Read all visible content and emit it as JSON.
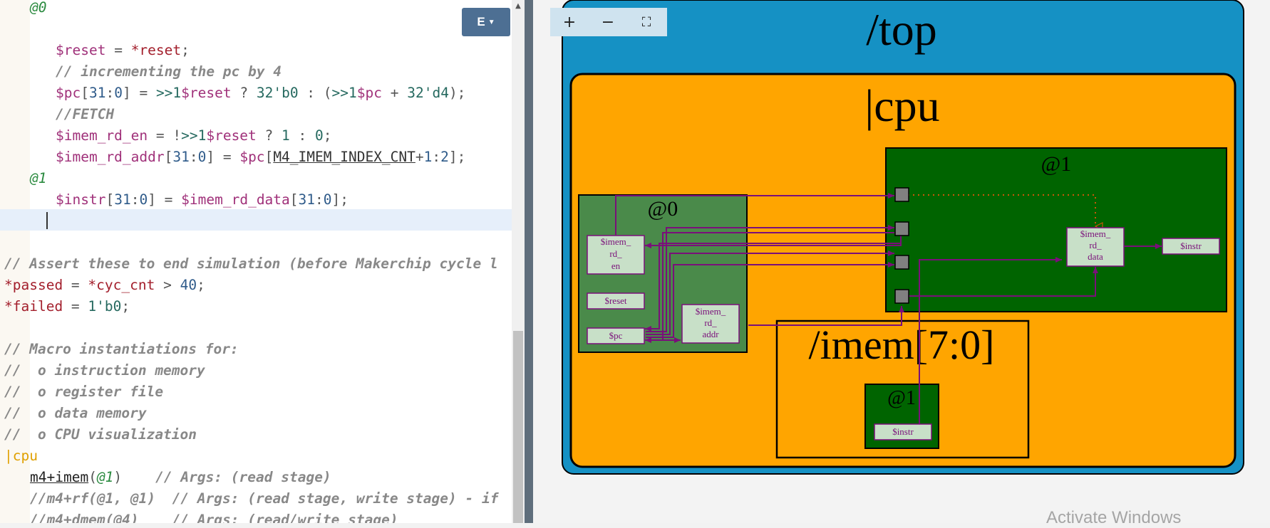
{
  "editor": {
    "stage_top": "@0",
    "line_reset": [
      "$reset",
      " = ",
      "*reset",
      ";"
    ],
    "comment_pc": "// incrementing the pc by 4",
    "line_pc": [
      "$pc",
      "[",
      "31",
      ":",
      "0",
      "] = ",
      ">>1",
      "$reset",
      " ? ",
      "32'b0",
      " : (",
      ">>1",
      "$pc",
      " + ",
      "32'd4",
      ");"
    ],
    "comment_fetch": "//FETCH",
    "line_en": [
      "$imem_rd_en",
      " = !",
      ">>1",
      "$reset",
      " ? ",
      "1",
      " : ",
      "0",
      ";"
    ],
    "line_addr": [
      "$imem_rd_addr",
      "[",
      "31",
      ":",
      "0",
      "] = ",
      "$pc",
      "[",
      "M4_IMEM_INDEX_CNT",
      "+",
      "1",
      ":",
      "2",
      "];"
    ],
    "stage_one": "@1",
    "line_instr": [
      "$instr",
      "[",
      "31",
      ":",
      "0",
      "] = ",
      "$imem_rd_data",
      "[",
      "31",
      ":",
      "0",
      "];"
    ],
    "comment_assert": "// Assert these to end simulation (before Makerchip cycle l",
    "line_passed": [
      "*passed",
      " = ",
      "*cyc_cnt",
      " > ",
      "40",
      ";"
    ],
    "line_failed": [
      "*failed",
      " = ",
      "1'b0",
      ";"
    ],
    "comment_macro": "// Macro instantiations for:",
    "comment_o1": "//  o instruction memory",
    "comment_o2": "//  o register file",
    "comment_o3": "//  o data memory",
    "comment_o4": "//  o CPU visualization",
    "pipe_cpu": "|cpu",
    "line_imem": [
      "m4+imem",
      "(",
      "@1",
      ")",
      "    // Args: (read stage)"
    ],
    "line_rf": "//m4+rf(@1, @1)  // Args: (read stage, write stage) - if",
    "line_dmem": "//m4+dmem(@4)    // Args: (read/write stage)",
    "e_button_label": "E"
  },
  "zoom": {
    "plus": "+",
    "minus": "−",
    "fit": "⛶"
  },
  "diagram": {
    "top_label": "/top",
    "cpu_label": "|cpu",
    "stage0_label": "@0",
    "stage1_label": "@1",
    "imem_label": "/imem[7:0]",
    "imem_stage_label": "@1",
    "node_imem_rd_en": [
      "$imem_",
      "rd_",
      "en"
    ],
    "node_reset": "$reset",
    "node_pc": "$pc",
    "node_imem_rd_addr": [
      "$imem_",
      "rd_",
      "addr"
    ],
    "node_imem_rd_data": [
      "$imem_",
      "rd_",
      "data"
    ],
    "node_instr": "$instr",
    "node_imem_instr": "$instr",
    "colors": {
      "top": "#1591c4",
      "cpu": "#ffa500",
      "stage0": "#4a8a4a",
      "stage1": "#006400",
      "node": "#c8e0c8",
      "wire": "#7a0f7a"
    }
  },
  "watermark": "Activate Windows"
}
